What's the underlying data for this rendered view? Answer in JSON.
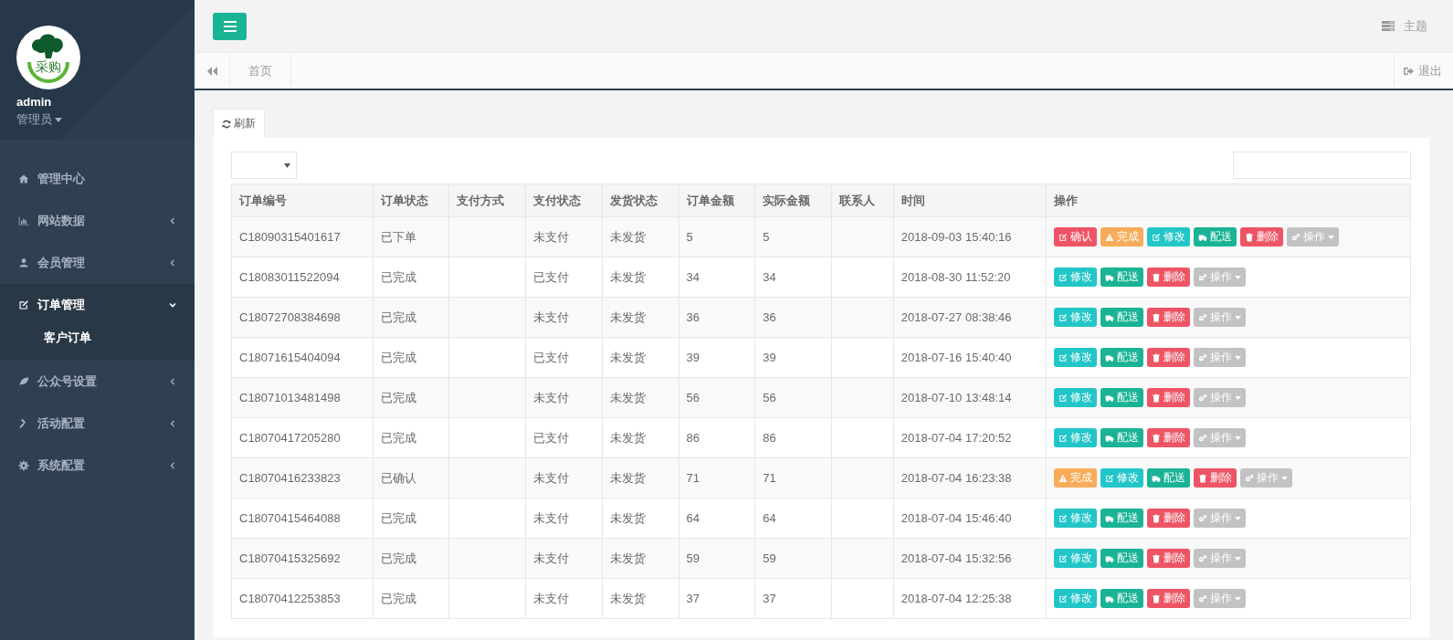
{
  "sidebar": {
    "logo_text": "采购",
    "user": {
      "name": "admin",
      "role": "管理员"
    },
    "items": [
      {
        "label": "管理中心",
        "has_arrow": false,
        "selected": false
      },
      {
        "label": "网站数据",
        "expanded": false,
        "has_arrow": true,
        "selected": false
      },
      {
        "label": "会员管理",
        "expanded": false,
        "has_arrow": true,
        "selected": false
      },
      {
        "label": "订单管理",
        "expanded": true,
        "has_arrow": true,
        "selected": true,
        "children": [
          {
            "label": "客户订单",
            "selected": true
          }
        ]
      },
      {
        "label": "公众号设置",
        "expanded": false,
        "has_arrow": true,
        "selected": false
      },
      {
        "label": "活动配置",
        "expanded": false,
        "has_arrow": true,
        "selected": false
      },
      {
        "label": "系统配置",
        "expanded": false,
        "has_arrow": true,
        "selected": false
      }
    ]
  },
  "topbar": {
    "theme_label": "主题"
  },
  "tabs": {
    "items": [
      {
        "label": "首页",
        "selected": false
      }
    ],
    "logout_label": "退出"
  },
  "toolbar": {
    "refresh_label": "刷新"
  },
  "table": {
    "columns": [
      "订单编号",
      "订单状态",
      "支付方式",
      "支付状态",
      "发货状态",
      "订单金额",
      "实际金额",
      "联系人",
      "时间",
      "操作"
    ],
    "rows": [
      {
        "order_no": "C18090315401617",
        "order_status": "已下单",
        "pay_status": "未支付",
        "ship_status": "未发货",
        "order_amount": "5",
        "actual_amount": "5",
        "time": "2018-09-03 15:40:16",
        "actions": [
          {
            "kind": "confirm",
            "label": "确认"
          },
          {
            "kind": "complete",
            "label": "完成"
          },
          {
            "kind": "edit",
            "label": "修改"
          },
          {
            "kind": "deliver",
            "label": "配送"
          },
          {
            "kind": "delete",
            "label": "删除"
          },
          {
            "kind": "more",
            "label": "操作"
          }
        ]
      },
      {
        "order_no": "C18083011522094",
        "order_status": "已完成",
        "pay_status": "已支付",
        "ship_status": "未发货",
        "order_amount": "34",
        "actual_amount": "34",
        "time": "2018-08-30 11:52:20",
        "actions": [
          {
            "kind": "edit",
            "label": "修改"
          },
          {
            "kind": "deliver",
            "label": "配送"
          },
          {
            "kind": "delete",
            "label": "删除"
          },
          {
            "kind": "more",
            "label": "操作"
          }
        ]
      },
      {
        "order_no": "C18072708384698",
        "order_status": "已完成",
        "pay_status": "未支付",
        "ship_status": "未发货",
        "order_amount": "36",
        "actual_amount": "36",
        "time": "2018-07-27 08:38:46",
        "actions": [
          {
            "kind": "edit",
            "label": "修改"
          },
          {
            "kind": "deliver",
            "label": "配送"
          },
          {
            "kind": "delete",
            "label": "删除"
          },
          {
            "kind": "more",
            "label": "操作"
          }
        ]
      },
      {
        "order_no": "C18071615404094",
        "order_status": "已完成",
        "pay_status": "已支付",
        "ship_status": "未发货",
        "order_amount": "39",
        "actual_amount": "39",
        "time": "2018-07-16 15:40:40",
        "actions": [
          {
            "kind": "edit",
            "label": "修改"
          },
          {
            "kind": "deliver",
            "label": "配送"
          },
          {
            "kind": "delete",
            "label": "删除"
          },
          {
            "kind": "more",
            "label": "操作"
          }
        ]
      },
      {
        "order_no": "C18071013481498",
        "order_status": "已完成",
        "pay_status": "未支付",
        "ship_status": "未发货",
        "order_amount": "56",
        "actual_amount": "56",
        "time": "2018-07-10 13:48:14",
        "actions": [
          {
            "kind": "edit",
            "label": "修改"
          },
          {
            "kind": "deliver",
            "label": "配送"
          },
          {
            "kind": "delete",
            "label": "删除"
          },
          {
            "kind": "more",
            "label": "操作"
          }
        ]
      },
      {
        "order_no": "C18070417205280",
        "order_status": "已完成",
        "pay_status": "已支付",
        "ship_status": "未发货",
        "order_amount": "86",
        "actual_amount": "86",
        "time": "2018-07-04 17:20:52",
        "actions": [
          {
            "kind": "edit",
            "label": "修改"
          },
          {
            "kind": "deliver",
            "label": "配送"
          },
          {
            "kind": "delete",
            "label": "删除"
          },
          {
            "kind": "more",
            "label": "操作"
          }
        ]
      },
      {
        "order_no": "C18070416233823",
        "order_status": "已确认",
        "pay_status": "未支付",
        "ship_status": "未发货",
        "order_amount": "71",
        "actual_amount": "71",
        "time": "2018-07-04 16:23:38",
        "actions": [
          {
            "kind": "complete",
            "label": "完成"
          },
          {
            "kind": "edit",
            "label": "修改"
          },
          {
            "kind": "deliver",
            "label": "配送"
          },
          {
            "kind": "delete",
            "label": "删除"
          },
          {
            "kind": "more",
            "label": "操作"
          }
        ]
      },
      {
        "order_no": "C18070415464088",
        "order_status": "已完成",
        "pay_status": "未支付",
        "ship_status": "未发货",
        "order_amount": "64",
        "actual_amount": "64",
        "time": "2018-07-04 15:46:40",
        "actions": [
          {
            "kind": "edit",
            "label": "修改"
          },
          {
            "kind": "deliver",
            "label": "配送"
          },
          {
            "kind": "delete",
            "label": "删除"
          },
          {
            "kind": "more",
            "label": "操作"
          }
        ]
      },
      {
        "order_no": "C18070415325692",
        "order_status": "已完成",
        "pay_status": "未支付",
        "ship_status": "未发货",
        "order_amount": "59",
        "actual_amount": "59",
        "time": "2018-07-04 15:32:56",
        "actions": [
          {
            "kind": "edit",
            "label": "修改"
          },
          {
            "kind": "deliver",
            "label": "配送"
          },
          {
            "kind": "delete",
            "label": "删除"
          },
          {
            "kind": "more",
            "label": "操作"
          }
        ]
      },
      {
        "order_no": "C18070412253853",
        "order_status": "已完成",
        "pay_status": "未支付",
        "ship_status": "未发货",
        "order_amount": "37",
        "actual_amount": "37",
        "time": "2018-07-04 12:25:38",
        "actions": [
          {
            "kind": "edit",
            "label": "修改"
          },
          {
            "kind": "deliver",
            "label": "配送"
          },
          {
            "kind": "delete",
            "label": "删除"
          },
          {
            "kind": "more",
            "label": "操作"
          }
        ]
      }
    ]
  }
}
